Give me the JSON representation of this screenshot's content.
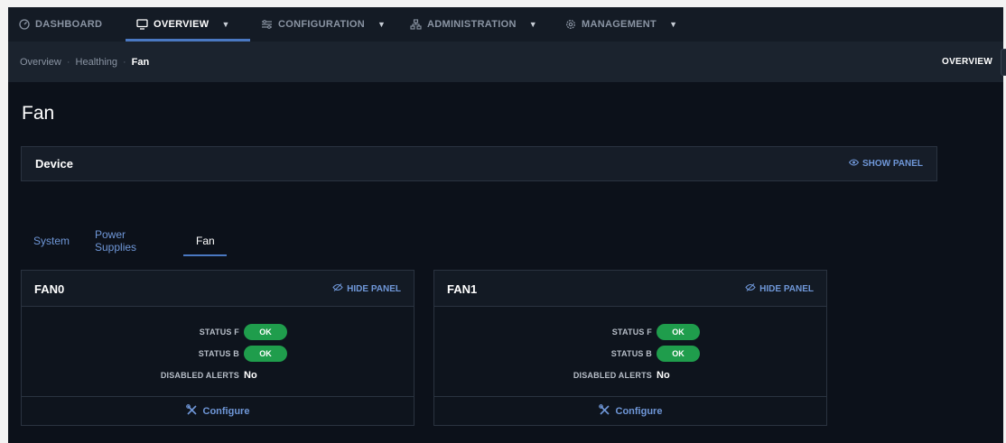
{
  "nav": {
    "items": [
      {
        "label": "DASHBOARD",
        "icon": "dashboard-icon",
        "active": false
      },
      {
        "label": "OVERVIEW",
        "icon": "monitor-icon",
        "active": true
      },
      {
        "label": "CONFIGURATION",
        "icon": "sliders-icon",
        "active": false
      },
      {
        "label": "ADMINISTRATION",
        "icon": "network-icon",
        "active": false
      },
      {
        "label": "MANAGEMENT",
        "icon": "gear-icon",
        "active": false
      }
    ]
  },
  "breadcrumb": {
    "items": [
      "Overview",
      "Healthing",
      "Fan"
    ],
    "right_label": "OVERVIEW"
  },
  "page": {
    "title": "Fan"
  },
  "device_panel": {
    "title": "Device",
    "action": "SHOW PANEL"
  },
  "tabs": {
    "items": [
      "System",
      "Power Supplies",
      "Fan"
    ],
    "active": "Fan"
  },
  "fans": [
    {
      "title": "FAN0",
      "action": "HIDE PANEL",
      "status_f_label": "STATUS F",
      "status_f": "OK",
      "status_b_label": "STATUS B",
      "status_b": "OK",
      "alerts_label": "DISABLED ALERTS",
      "alerts": "No",
      "configure": "Configure"
    },
    {
      "title": "FAN1",
      "action": "HIDE PANEL",
      "status_f_label": "STATUS F",
      "status_f": "OK",
      "status_b_label": "STATUS B",
      "status_b": "OK",
      "alerts_label": "DISABLED ALERTS",
      "alerts": "No",
      "configure": "Configure"
    }
  ],
  "colors": {
    "background": "#0c111a",
    "accent": "#6f97d8",
    "ok": "#1f9d4c"
  }
}
